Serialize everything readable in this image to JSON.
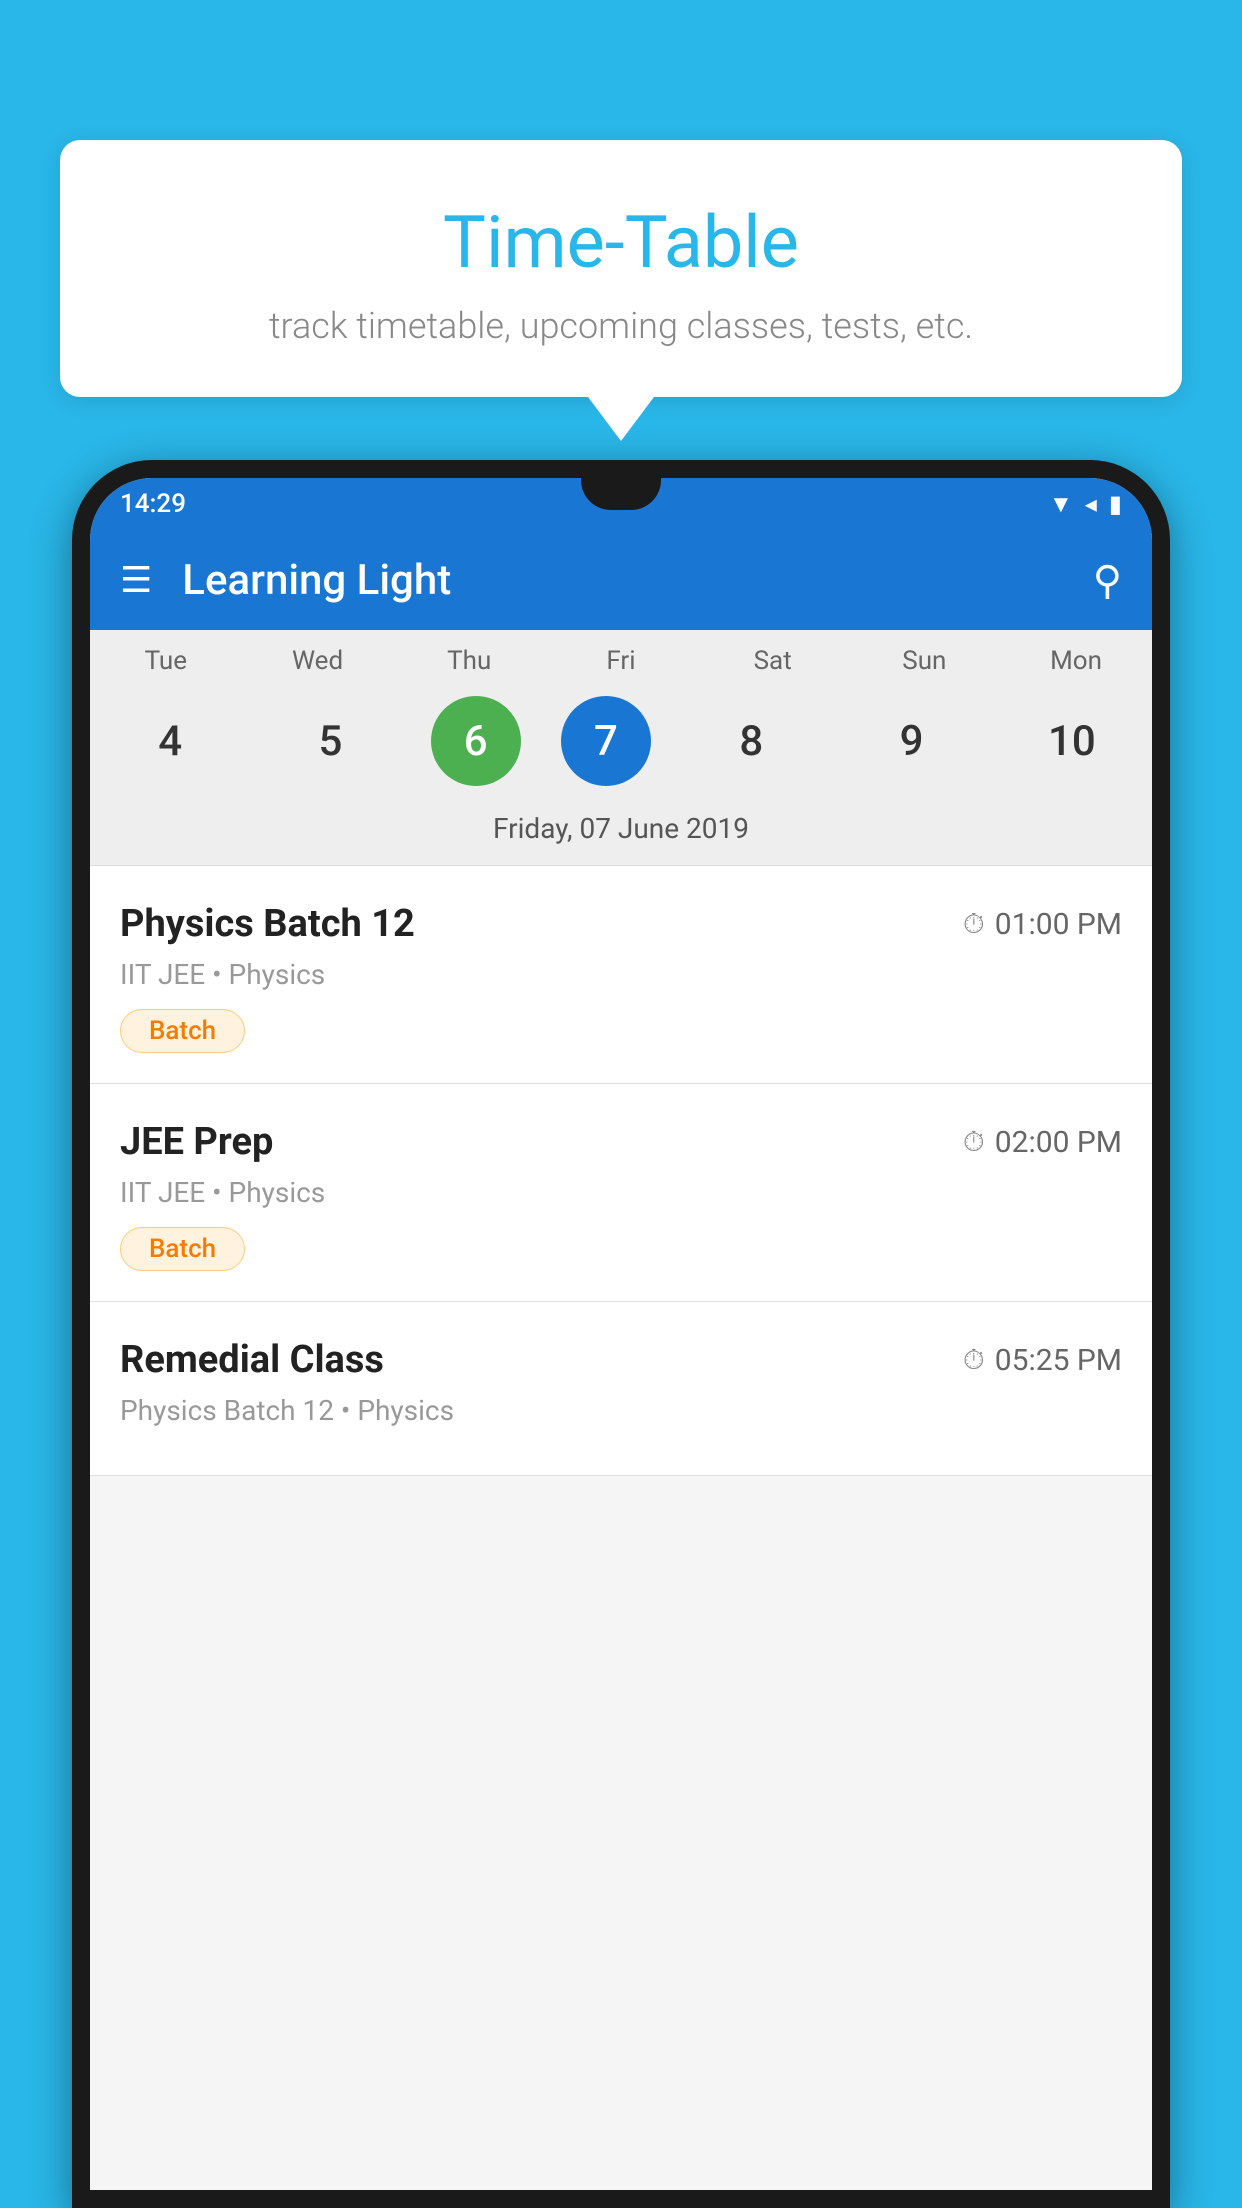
{
  "background_color": "#29b6e8",
  "bubble": {
    "title": "Time-Table",
    "subtitle": "track timetable, upcoming classes, tests, etc."
  },
  "phone": {
    "status_bar": {
      "time": "14:29"
    },
    "app_bar": {
      "title": "Learning Light"
    },
    "calendar": {
      "days": [
        "Tue",
        "Wed",
        "Thu",
        "Fri",
        "Sat",
        "Sun",
        "Mon"
      ],
      "dates": [
        "4",
        "5",
        "6",
        "7",
        "8",
        "9",
        "10"
      ],
      "today_index": 2,
      "selected_index": 3,
      "selected_date_label": "Friday, 07 June 2019"
    },
    "schedule_items": [
      {
        "title": "Physics Batch 12",
        "time": "01:00 PM",
        "meta": "IIT JEE • Physics",
        "badge": "Batch"
      },
      {
        "title": "JEE Prep",
        "time": "02:00 PM",
        "meta": "IIT JEE • Physics",
        "badge": "Batch"
      },
      {
        "title": "Remedial Class",
        "time": "05:25 PM",
        "meta": "Physics Batch 12 • Physics",
        "badge": null
      }
    ]
  }
}
